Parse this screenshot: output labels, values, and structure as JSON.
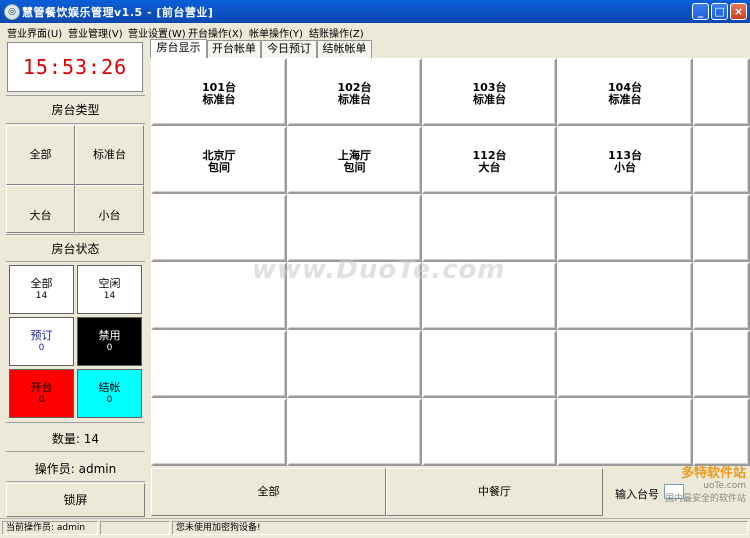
{
  "window": {
    "title": "慧管餐饮娱乐管理v1.5 - [前台营业]"
  },
  "menu": [
    "营业界面(U)",
    "营业管理(V)",
    "营业设置(W)",
    "开台操作(X)",
    "帐单操作(Y)",
    "结账操作(Z)"
  ],
  "clock": "15:53:26",
  "room_types": {
    "title": "房台类型",
    "buttons": [
      "全部",
      "标准台",
      "大台",
      "小台"
    ]
  },
  "room_status": {
    "title": "房台状态",
    "buttons": [
      {
        "label": "全部",
        "count": "14",
        "bg": "#ffffff",
        "fg": "#000000"
      },
      {
        "label": "空闲",
        "count": "14",
        "bg": "#ffffff",
        "fg": "#000000"
      },
      {
        "label": "预订",
        "count": "0",
        "bg": "#ffffff",
        "fg": "#1a1a9a"
      },
      {
        "label": "禁用",
        "count": "0",
        "bg": "#000000",
        "fg": "#ffffff"
      },
      {
        "label": "开台",
        "count": "0",
        "bg": "#ff0000",
        "fg": "#000000"
      },
      {
        "label": "结帐",
        "count": "0",
        "bg": "#00ffff",
        "fg": "#000000"
      }
    ]
  },
  "count_text": "数量: 14",
  "operator_text": "操作员: admin",
  "lock_button": "锁屏",
  "tabs": [
    "房台显示",
    "开台帐单",
    "今日预订",
    "结帐帐单"
  ],
  "tables": [
    {
      "name": "101台",
      "type": "标准台"
    },
    {
      "name": "102台",
      "type": "标准台"
    },
    {
      "name": "103台",
      "type": "标准台"
    },
    {
      "name": "104台",
      "type": "标准台"
    },
    {
      "name": "北京厅",
      "type": "包间"
    },
    {
      "name": "上海厅",
      "type": "包间"
    },
    {
      "name": "112台",
      "type": "大台"
    },
    {
      "name": "113台",
      "type": "小台"
    }
  ],
  "bottom": {
    "btn1": "全部",
    "btn2": "中餐厅",
    "input_label": "输入台号"
  },
  "status": {
    "operator": "当前操作员: admin",
    "message": "您未使用加密狗设备!"
  },
  "watermark": "www.DuoTe.com",
  "corner_text": {
    "brand": "多特软件站",
    "site": "uoTe.com",
    "slogan": "国内最安全的软件站"
  }
}
